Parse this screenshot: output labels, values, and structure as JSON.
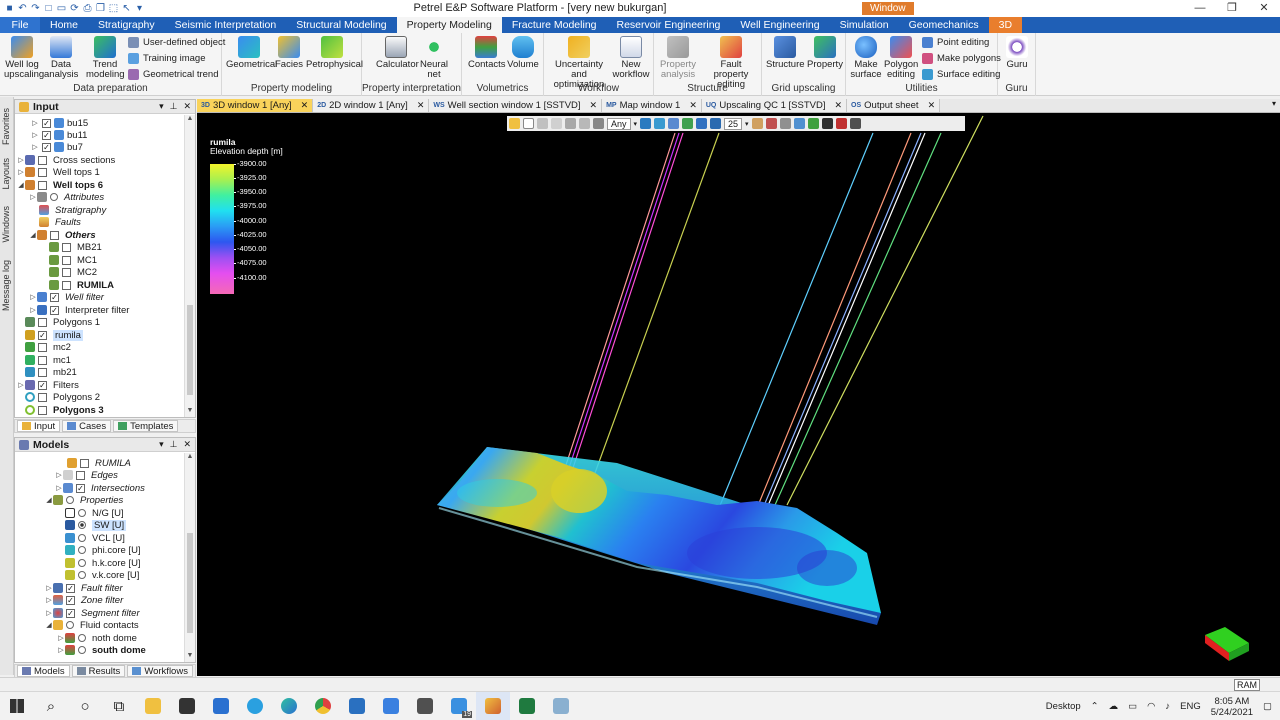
{
  "window": {
    "title": "Petrel E&P Software Platform - [very new bukurgan]",
    "minimize": "—",
    "maximize": "❐",
    "close": "✕"
  },
  "ribbon_tabs": [
    {
      "label": "File"
    },
    {
      "label": "Home"
    },
    {
      "label": "Stratigraphy"
    },
    {
      "label": "Seismic Interpretation"
    },
    {
      "label": "Structural Modeling"
    },
    {
      "label": "Property Modeling"
    },
    {
      "label": "Fracture Modeling"
    },
    {
      "label": "Reservoir Engineering"
    },
    {
      "label": "Well Engineering"
    },
    {
      "label": "Simulation"
    },
    {
      "label": "Geomechanics"
    },
    {
      "label": "3D"
    }
  ],
  "context_tab": "Window",
  "ribbon": {
    "data_preparation": {
      "label": "Data preparation",
      "well_log_upscaling": "Well log upscaling",
      "data_analysis": "Data analysis",
      "trend_modeling": "Trend modeling",
      "user_defined_object": "User-defined object",
      "training_image": "Training image",
      "geometrical_trend": "Geometrical trend"
    },
    "property_modeling": {
      "label": "Property modeling",
      "geometrical": "Geometrical",
      "facies": "Facies",
      "petrophysical": "Petrophysical"
    },
    "property_interpretation": {
      "label": "Property interpretation",
      "calculator": "Calculator",
      "neural_net": "Neural net"
    },
    "volumetrics": {
      "label": "Volumetrics",
      "contacts": "Contacts",
      "volume": "Volume"
    },
    "workflow": {
      "label": "Workflow",
      "uncertainty": "Uncertainty and optimization",
      "new_workflow": "New workflow"
    },
    "structure": {
      "label": "Structure",
      "property_analysis": "Property analysis",
      "fault_property_editing": "Fault property editing"
    },
    "grid_upscaling": {
      "label": "Grid upscaling",
      "structure": "Structure",
      "property": "Property"
    },
    "utilities": {
      "label": "Utilities",
      "make_surface": "Make surface",
      "polygon_editing": "Polygon editing",
      "point_editing": "Point editing",
      "make_polygons": "Make polygons",
      "surface_editing": "Surface editing"
    },
    "guru": {
      "label": "Guru",
      "guru": "Guru"
    }
  },
  "side_tabs": [
    "Favorites",
    "Layouts",
    "Windows",
    "Message log"
  ],
  "input_panel": {
    "title": "Input",
    "rows": [
      {
        "label": "bu15",
        "checked": true
      },
      {
        "label": "bu11",
        "checked": true
      },
      {
        "label": "bu7",
        "checked": true
      },
      {
        "label": "Cross sections",
        "checked": false
      },
      {
        "label": "Well tops 1",
        "checked": false
      },
      {
        "label": "Well tops 6",
        "checked": false
      },
      {
        "label": "Attributes",
        "checked": false
      },
      {
        "label": "Stratigraphy"
      },
      {
        "label": "Faults"
      },
      {
        "label": "Others",
        "checked": false
      },
      {
        "label": "MB21",
        "checked": false
      },
      {
        "label": "MC1",
        "checked": false
      },
      {
        "label": "MC2",
        "checked": false
      },
      {
        "label": "RUMILA",
        "checked": false
      },
      {
        "label": "Well filter",
        "checked": true
      },
      {
        "label": "Interpreter filter",
        "checked": true
      },
      {
        "label": "Polygons 1",
        "checked": false
      },
      {
        "label": "rumila",
        "checked": true
      },
      {
        "label": "mc2",
        "checked": false
      },
      {
        "label": "mc1",
        "checked": false
      },
      {
        "label": "mb21",
        "checked": false
      },
      {
        "label": "Filters",
        "checked": true
      },
      {
        "label": "Polygons 2",
        "checked": false
      },
      {
        "label": "Polygons 3",
        "checked": false
      }
    ],
    "tabs": [
      "Input",
      "Cases",
      "Templates"
    ]
  },
  "models_panel": {
    "title": "Models",
    "rows": [
      {
        "label": "RUMILA"
      },
      {
        "label": "Edges"
      },
      {
        "label": "Intersections"
      },
      {
        "label": "Properties"
      },
      {
        "label": "N/G [U]"
      },
      {
        "label": "SW [U]"
      },
      {
        "label": "VCL [U]"
      },
      {
        "label": "phi.core [U]"
      },
      {
        "label": "h.k.core [U]"
      },
      {
        "label": "v.k.core [U]"
      },
      {
        "label": "Fault filter"
      },
      {
        "label": "Zone filter"
      },
      {
        "label": "Segment filter"
      },
      {
        "label": "Fluid contacts"
      },
      {
        "label": "noth dome"
      },
      {
        "label": "south dome"
      }
    ],
    "tabs": [
      "Models",
      "Results",
      "Workflows"
    ]
  },
  "doc_tabs": [
    {
      "label": "3D window 1 [Any]",
      "icon": "3D"
    },
    {
      "label": "2D window 1 [Any]",
      "icon": "2D"
    },
    {
      "label": "Well section window 1 [SSTVD]",
      "icon": "WS"
    },
    {
      "label": "Map window 1",
      "icon": "MP"
    },
    {
      "label": "Upscaling QC 1 [SSTVD]",
      "icon": "UQ"
    },
    {
      "label": "Output sheet",
      "icon": "OS"
    }
  ],
  "viewer": {
    "domain_select": "Any",
    "zoom_select": "25",
    "legend": {
      "name": "rumila",
      "property": "Elevation depth [m]",
      "ticks": [
        "-3900.00",
        "-3925.00",
        "-3950.00",
        "-3975.00",
        "-4000.00",
        "-4025.00",
        "-4050.00",
        "-4075.00",
        "-4100.00"
      ]
    }
  },
  "status": {
    "ram": "RAM"
  },
  "taskbar": {
    "desktop": "Desktop",
    "lang": "ENG",
    "time": "8:05 AM",
    "date": "5/24/2021",
    "badge": "19"
  }
}
